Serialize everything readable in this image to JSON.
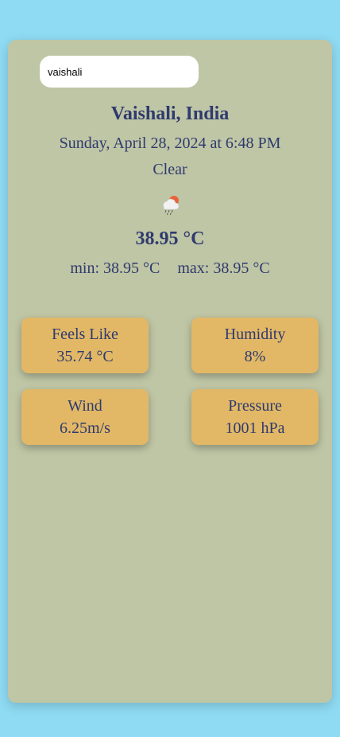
{
  "search": {
    "value": "vaishali",
    "placeholder": ""
  },
  "location": {
    "name": "Vaishali, India"
  },
  "datetime": "Sunday, April 28, 2024 at 6:48 PM",
  "condition": "Clear",
  "icon": "cloud-rain-sun-icon",
  "temperature": "38.95 °C",
  "min": "min: 38.95 °C",
  "max": "max: 38.95 °C",
  "details": {
    "feels_like": {
      "label": "Feels Like",
      "value": "35.74 °C"
    },
    "humidity": {
      "label": "Humidity",
      "value": "8%"
    },
    "wind": {
      "label": "Wind",
      "value": "6.25m/s"
    },
    "pressure": {
      "label": "Pressure",
      "value": "1001 hPa"
    }
  },
  "colors": {
    "page_background": "#8fdbf3",
    "card_background": "#bfc6a5",
    "tile_background": "#e2b866",
    "text": "#2f3a6e"
  }
}
